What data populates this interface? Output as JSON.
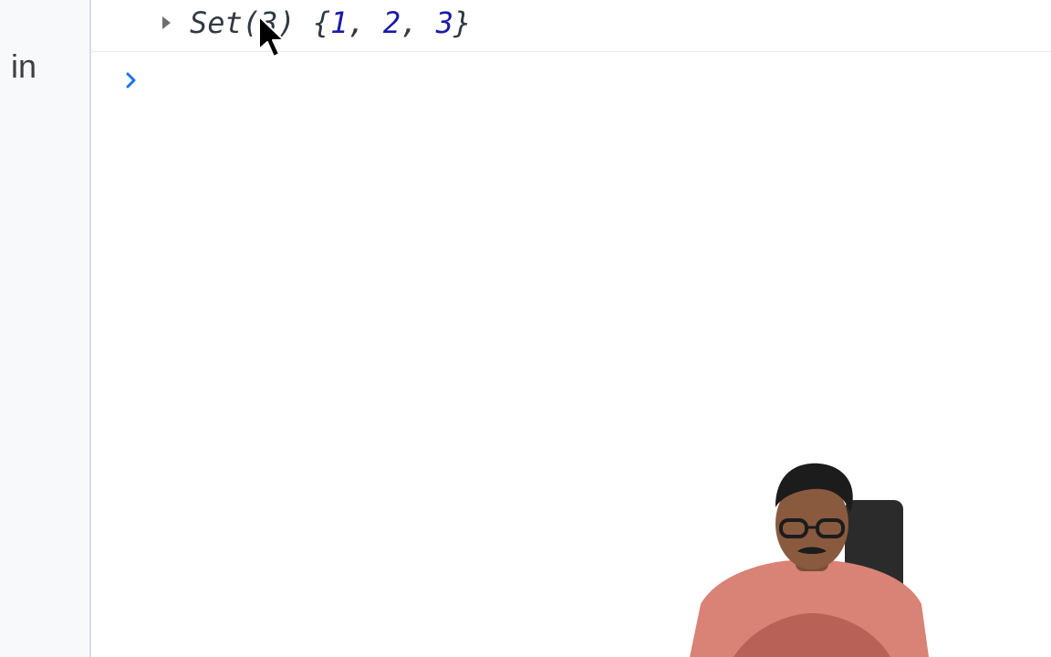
{
  "sidebar": {
    "visible_text": "in"
  },
  "console": {
    "log_entry": {
      "prefix": "Set(3) {",
      "values": [
        "1",
        "2",
        "3"
      ],
      "separator": ", ",
      "suffix": "}"
    },
    "prompt_symbol_icon": "chevron-right-icon"
  },
  "colors": {
    "number_value": "#1a1aa6",
    "prompt_blue": "#1a73e8",
    "console_text": "#303942",
    "divider": "#dadce0"
  }
}
